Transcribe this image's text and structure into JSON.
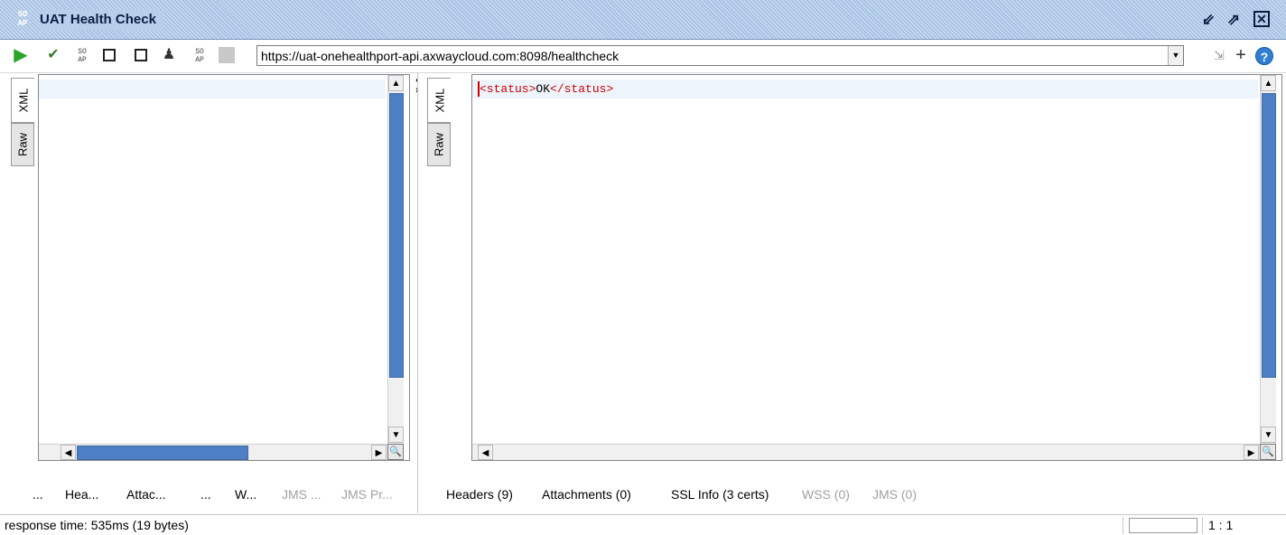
{
  "window": {
    "title": "UAT Health Check",
    "logo_text_top": "SO",
    "logo_text_bottom": "AP"
  },
  "toolbar": {
    "url": "https://uat-onehealthport-api.axwaycloud.com:8098/healthcheck",
    "help_label": "?"
  },
  "request_panel": {
    "side_tabs": [
      "XML",
      "Raw"
    ],
    "bottom_tabs": [
      {
        "label": "...",
        "enabled": true
      },
      {
        "label": "Hea...",
        "enabled": true
      },
      {
        "label": "Attac...",
        "enabled": true
      },
      {
        "label": "...",
        "enabled": true
      },
      {
        "label": "W...",
        "enabled": true
      },
      {
        "label": "JMS ...",
        "enabled": false
      },
      {
        "label": "JMS Pr...",
        "enabled": false
      }
    ]
  },
  "response_panel": {
    "side_tabs": [
      "XML",
      "Raw"
    ],
    "content": {
      "open_tag": "<status>",
      "value": "OK",
      "close_tag": "</status>"
    },
    "bottom_tabs": [
      {
        "label": "Headers (9)",
        "enabled": true
      },
      {
        "label": "Attachments (0)",
        "enabled": true
      },
      {
        "label": "SSL Info (3 certs)",
        "enabled": true
      },
      {
        "label": "WSS (0)",
        "enabled": false
      },
      {
        "label": "JMS (0)",
        "enabled": false
      }
    ]
  },
  "statusbar": {
    "response_info": "response time: 535ms (19 bytes)",
    "cursor_position": "1 : 1"
  }
}
